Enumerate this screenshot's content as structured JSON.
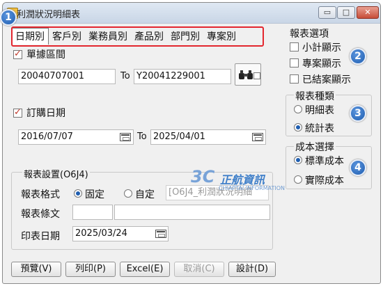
{
  "window": {
    "title": "利潤狀況明細表",
    "controls": {
      "minimize": "▭",
      "maximize": "□",
      "close": "✕"
    }
  },
  "tabs": [
    "日期別",
    "客戶別",
    "業務員別",
    "產品別",
    "部門別",
    "專案別"
  ],
  "badges": [
    "1",
    "2",
    "3",
    "4"
  ],
  "document_no": {
    "label": "單據區間",
    "checked": true,
    "from": "20040707001",
    "to_label": "To",
    "to": "Y20041229001"
  },
  "order_date": {
    "label": "訂購日期",
    "checked": true,
    "from": "2016/07/07",
    "to_label": "To",
    "to": "2025/04/01"
  },
  "report_options": {
    "title": "報表選項",
    "items": [
      {
        "label": "小計顯示",
        "checked": false
      },
      {
        "label": "專案顯示",
        "checked": false
      },
      {
        "label": "已結案顯示",
        "checked": false
      }
    ]
  },
  "report_type": {
    "title": "報表種類",
    "options": [
      {
        "label": "明細表",
        "selected": false
      },
      {
        "label": "統計表",
        "selected": true
      }
    ]
  },
  "cost_choice": {
    "title": "成本選擇",
    "options": [
      {
        "label": "標準成本",
        "selected": true
      },
      {
        "label": "實際成本",
        "selected": false
      }
    ]
  },
  "report_settings": {
    "title": "報表設置(O6J4)",
    "format_label": "報表格式",
    "format_options": [
      {
        "label": "固定",
        "selected": true
      },
      {
        "label": "自定",
        "selected": false
      }
    ],
    "format_value": "[O6J4_利潤狀況明細",
    "clause_label": "報表條文",
    "clause_value_1": "",
    "clause_value_2": "",
    "print_date_label": "印表日期",
    "print_date": "2025/03/24"
  },
  "buttons": {
    "preview": "預覽(V)",
    "print": "列印(P)",
    "excel": "Excel(E)",
    "cancel": "取消(C)",
    "design": "設計(D)"
  },
  "watermark": {
    "logo": "3C",
    "text": "正航資訊",
    "subtext": "CHIAPTAI INFORMATION"
  },
  "colors": {
    "highlight": "#e3262e",
    "badge": "#1f5eb0",
    "window_bg": "#f0f0f0"
  }
}
